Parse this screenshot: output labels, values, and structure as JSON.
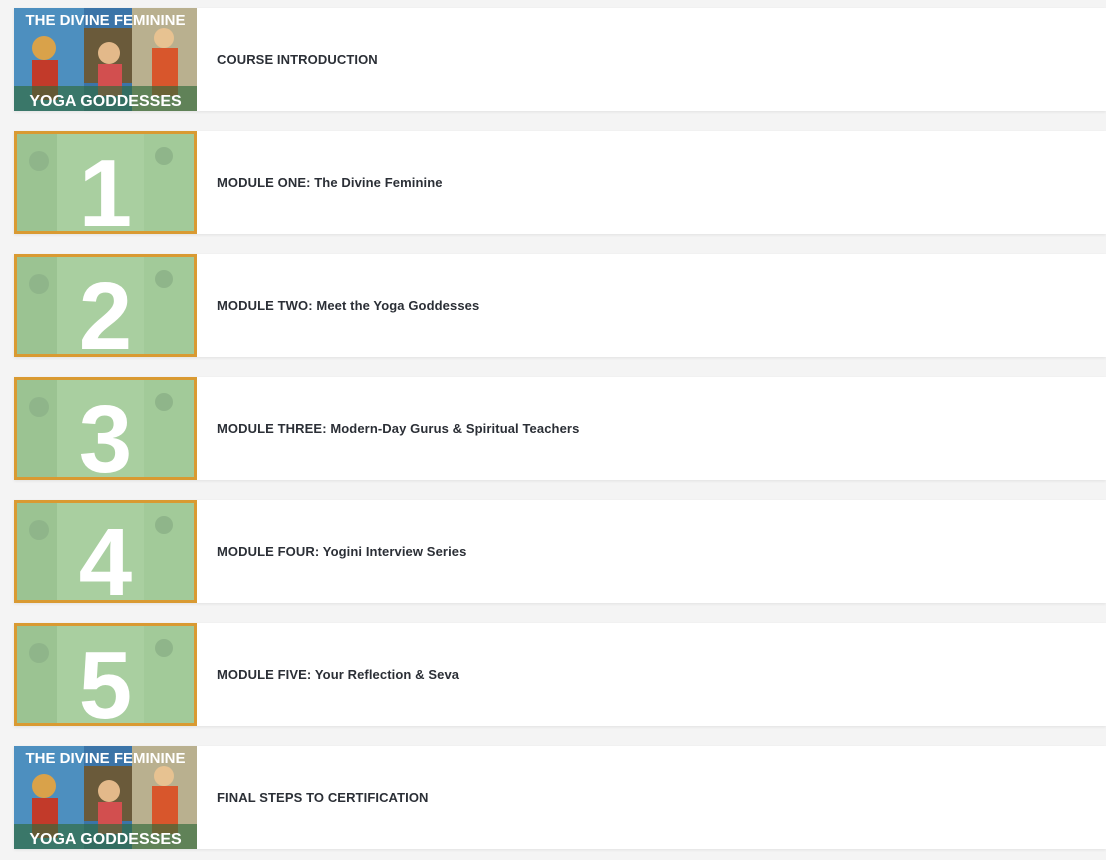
{
  "course": {
    "thumb_top_text": "THE DIVINE FEMININE",
    "thumb_bottom_text": "YOGA GODDESSES",
    "items": [
      {
        "kind": "cover",
        "title": "COURSE INTRODUCTION"
      },
      {
        "kind": "module",
        "number": "1",
        "title": "MODULE ONE: The Divine Feminine"
      },
      {
        "kind": "module",
        "number": "2",
        "title": "MODULE TWO: Meet the Yoga Goddesses"
      },
      {
        "kind": "module",
        "number": "3",
        "title": "MODULE THREE: Modern-Day Gurus & Spiritual Teachers"
      },
      {
        "kind": "module",
        "number": "4",
        "title": "MODULE FOUR: Yogini Interview Series"
      },
      {
        "kind": "module",
        "number": "5",
        "title": "MODULE FIVE: Your Reflection & Seva"
      },
      {
        "kind": "cover",
        "title": "FINAL STEPS TO CERTIFICATION"
      }
    ]
  },
  "colors": {
    "frame_gold": "#d99a32",
    "module_green": "#a9cfa0",
    "numeral": "#ffffff",
    "cover_sky": "#3b74a8",
    "cover_text": "#ffffff",
    "title_text": "#2b2f36"
  }
}
